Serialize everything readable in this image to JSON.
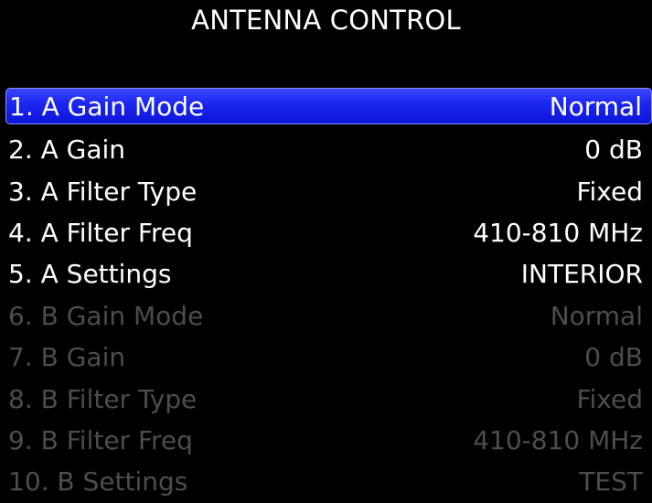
{
  "title": "ANTENNA CONTROL",
  "menu": {
    "items": [
      {
        "label": "1. A Gain Mode",
        "value": "Normal",
        "state": "selected"
      },
      {
        "label": "2. A Gain",
        "value": "0 dB",
        "state": "enabled"
      },
      {
        "label": "3. A Filter Type",
        "value": "Fixed",
        "state": "enabled"
      },
      {
        "label": "4. A Filter Freq",
        "value": "410-810 MHz",
        "state": "enabled"
      },
      {
        "label": "5. A Settings",
        "value": "INTERIOR",
        "state": "enabled"
      },
      {
        "label": "6. B Gain Mode",
        "value": "Normal",
        "state": "disabled"
      },
      {
        "label": "7. B Gain",
        "value": "0 dB",
        "state": "disabled"
      },
      {
        "label": "8. B Filter Type",
        "value": "Fixed",
        "state": "disabled"
      },
      {
        "label": "9. B Filter Freq",
        "value": "410-810 MHz",
        "state": "disabled"
      },
      {
        "label": "10. B Settings",
        "value": "TEST",
        "state": "disabled"
      }
    ]
  },
  "colors": {
    "background": "#000000",
    "text": "#ffffff",
    "disabled_text": "#4d4d4d",
    "selection": "#1a25f0"
  }
}
